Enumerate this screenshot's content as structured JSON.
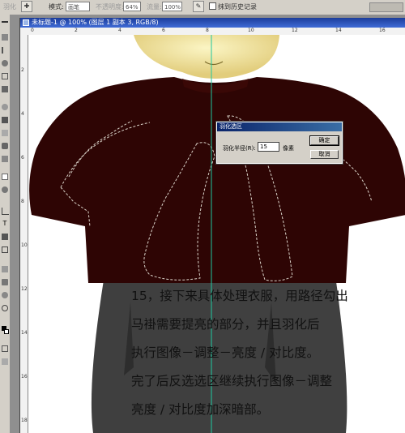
{
  "options_bar": {
    "feather_label": "羽化",
    "mode_label": "模式:",
    "mode_value": "画笔",
    "opacity_label": "不透明度:",
    "opacity_value": "64%",
    "flow_label": "流量:",
    "flow_value": "100%",
    "erase_history_label": "抹到历史记录"
  },
  "document": {
    "title": "未标题-1 @ 100% (图层 1 副本 3, RGB/8)",
    "ruler_h": [
      "0",
      "2",
      "4",
      "6",
      "8",
      "10",
      "12",
      "14",
      "16"
    ],
    "ruler_v": [
      "2",
      "4",
      "6",
      "8",
      "10",
      "12",
      "14",
      "16",
      "18"
    ]
  },
  "dialog": {
    "title": "羽化选区",
    "radius_label": "羽化半径(R):",
    "radius_value": "15",
    "unit": "像素",
    "ok_label": "确定",
    "cancel_label": "取消"
  },
  "caption": {
    "lines": [
      "15，接下来具体处理衣服，用路径勾出",
      "马褂需要提亮的部分，并且羽化后",
      "执行图像－调整－亮度 / 对比度。",
      "完了后反选选区继续执行图像－调整",
      "亮度 / 对比度加深暗部。"
    ]
  },
  "colors": {
    "coat": "#2e0504",
    "pants": "#404040",
    "skin": "#f3e6a0",
    "guide": "#1fc8a0",
    "title_bar": "#1c3d9a"
  }
}
